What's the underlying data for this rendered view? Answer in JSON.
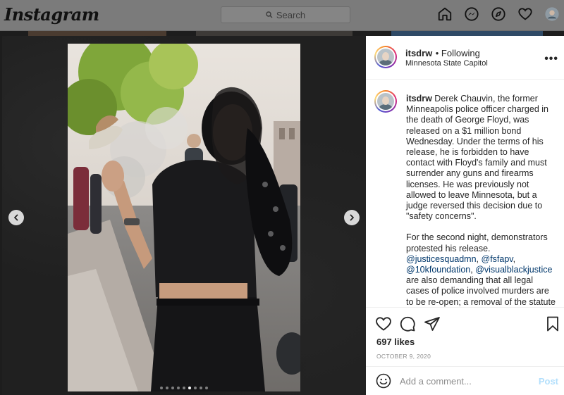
{
  "topbar": {
    "logo": "Instagram",
    "search_placeholder": "Search",
    "icons": [
      "home-icon",
      "messenger-icon",
      "explore-icon",
      "heart-icon",
      "profile-avatar"
    ]
  },
  "post": {
    "username": "itsdrw",
    "following": "• Following",
    "location": "Minnesota State Capitol",
    "more": "•••",
    "carousel": {
      "total": 9,
      "active_index": 5
    },
    "caption": {
      "username": "itsdrw",
      "para1": "Derek Chauvin, the former Minneapolis police officer charged in the death of George Floyd, was released on a $1 million bond Wednesday. Under the terms of his release, he is forbidden to have contact with Floyd's family and must surrender any guns and firearms licenses. He was previously not allowed to leave Minnesota, but a judge reversed this decision due to \"safety concerns\".",
      "para2_a": "For the second night, demonstrators protested his release.",
      "tag1": "@justicesquadmn",
      "tag2": "@fsfapv",
      "tag3": "@10kfoundation",
      "tag4": "@visualblackjustice",
      "para2_b": "are also demanding that all legal cases of police involved murders are to be re-open; a removal of the statute of limitations"
    },
    "likes": "697 likes",
    "date": "OCTOBER 9, 2020",
    "comment_placeholder": "Add a comment...",
    "post_button": "Post"
  },
  "colors": {
    "accent_link": "#00376b",
    "post_disabled": "#b2dffc"
  }
}
